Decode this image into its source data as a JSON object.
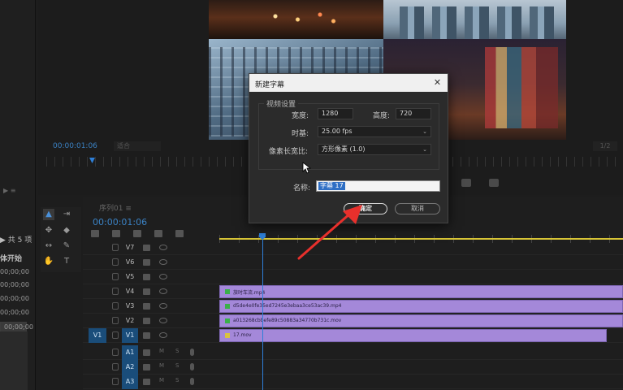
{
  "program_monitor": {
    "timecode": "00:00:01:06",
    "fit": "适合",
    "fraction": "1/2"
  },
  "project_panel": {
    "count_label": "▶ 共 5 项",
    "column_header": "体开始",
    "rows": [
      "00;00;00",
      "00;00;00",
      "00;00;00",
      "00;00;00",
      "00;00;00"
    ]
  },
  "timeline": {
    "tab_label": "序列01  ≡",
    "timecode": "00:00:01:06",
    "video_tracks": [
      {
        "label": "V7",
        "clip": null
      },
      {
        "label": "V6",
        "clip": null
      },
      {
        "label": "V5",
        "clip": null
      },
      {
        "label": "V4",
        "clip": "旅时车流.mp4"
      },
      {
        "label": "V3",
        "clip": "d5de4e0fe35ed7245e3ebaa3ce53ac39.mp4"
      },
      {
        "label": "V2",
        "clip": "a013268cbbefe89c50883a34770b731c.mov"
      },
      {
        "label": "V1",
        "clip": "17.mov",
        "source": "V1"
      }
    ],
    "audio_tracks": [
      {
        "label": "A1",
        "m": "M",
        "s": "S"
      },
      {
        "label": "A2",
        "m": "M",
        "s": "S"
      },
      {
        "label": "A3",
        "m": "M",
        "s": "S"
      }
    ]
  },
  "dialog": {
    "title": "新建字幕",
    "close": "✕",
    "section_title": "视频设置",
    "width_label": "宽度:",
    "width_value": "1280",
    "height_label": "高度:",
    "height_value": "720",
    "timebase_label": "时基:",
    "timebase_value": "25.00 fps",
    "pixel_aspect_label": "像素长宽比:",
    "pixel_aspect_value": "方形像素 (1.0)",
    "name_label": "名称:",
    "name_value": "字幕 17",
    "ok_label": "确定",
    "cancel_label": "取消"
  },
  "colors": {
    "timecode_blue": "#3b82c4",
    "clip_purple": "#a488d9",
    "selection_blue": "#2f6fc4",
    "annotation_red": "#e8302c"
  }
}
